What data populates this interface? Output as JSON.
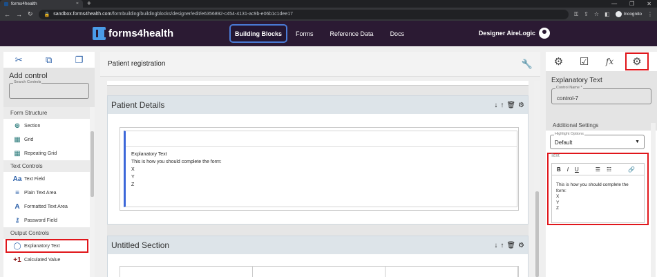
{
  "browser": {
    "tab_title": "forms4health",
    "tab_close": "×",
    "new_tab": "+",
    "url_host": "sandbox.forms4health.com",
    "url_path": "/formbuilding/buildingblocks/designer/edit/e6356892-c454-4131-ac9b-e06b1c1dee17",
    "incognito_label": "Incognito"
  },
  "app": {
    "logo_text": "forms4health",
    "nav": [
      "Building Blocks",
      "Forms",
      "Reference Data",
      "Docs"
    ],
    "active_nav": "Building Blocks",
    "user_name": "Designer AireLogic"
  },
  "left_panel": {
    "title": "Add control",
    "search_label": "Search Controls",
    "groups": [
      {
        "header": "Form Structure",
        "items": [
          {
            "label": "Section",
            "icon": "section-icon"
          },
          {
            "label": "Grid",
            "icon": "grid-icon"
          },
          {
            "label": "Repeating Grid",
            "icon": "repeating-grid-icon"
          }
        ]
      },
      {
        "header": "Text Controls",
        "items": [
          {
            "label": "Text Field",
            "icon": "text-field-icon"
          },
          {
            "label": "Plain Text Area",
            "icon": "plain-text-area-icon"
          },
          {
            "label": "Formatted Text Area",
            "icon": "formatted-text-area-icon"
          },
          {
            "label": "Password Field",
            "icon": "password-field-icon"
          }
        ]
      },
      {
        "header": "Output Controls",
        "items": [
          {
            "label": "Explanatory Text",
            "icon": "speech-bubble-icon"
          },
          {
            "label": "Calculated Value",
            "icon": "plus-one-icon"
          }
        ]
      }
    ]
  },
  "center": {
    "title": "Patient registration",
    "sections": [
      {
        "title": "Patient Details",
        "control_title": "Explanatory Text",
        "control_lines": [
          "This is how you should complete the form:",
          "X",
          "Y",
          "Z"
        ]
      },
      {
        "title": "Untitled Section"
      }
    ]
  },
  "right_panel": {
    "heading": "Explanatory Text",
    "control_name_label": "Control Name *",
    "control_name_value": "control-7",
    "additional_settings": "Additional Settings",
    "highlight_label": "Highlight Options",
    "highlight_value": "Default",
    "text_label": "Text",
    "toolbar": {
      "bold": "B",
      "italic": "I",
      "underline": "U"
    },
    "editor_text": "This is how you should complete the form:",
    "editor_lines": [
      "X",
      "Y",
      "Z"
    ]
  },
  "colors": {
    "header_bg": "#2b1a33",
    "accent": "#4a7bd6",
    "highlight_red": "#e0161b",
    "section_bar": "#3c67d9"
  }
}
